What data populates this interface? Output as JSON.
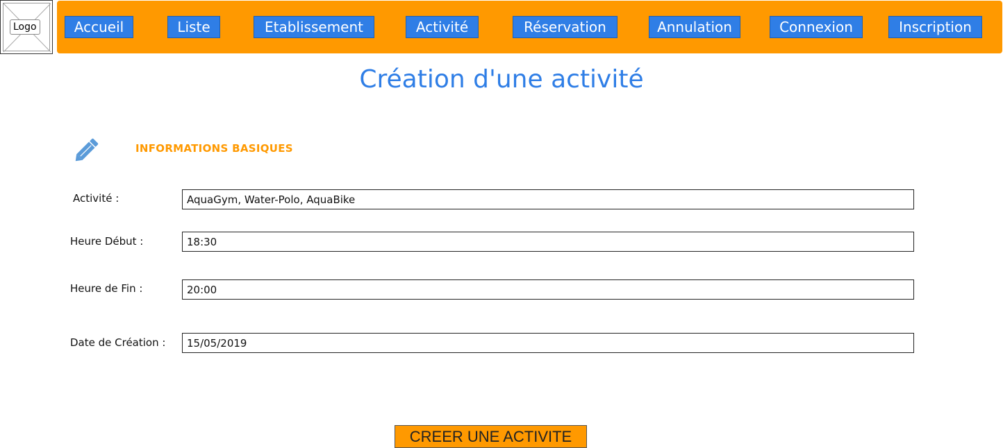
{
  "logo": {
    "label": "Logo"
  },
  "nav": {
    "items": [
      {
        "label": "Accueil"
      },
      {
        "label": "Liste"
      },
      {
        "label": "Etablissement"
      },
      {
        "label": "Activité"
      },
      {
        "label": "Réservation"
      },
      {
        "label": "Annulation"
      },
      {
        "label": "Connexion"
      },
      {
        "label": "Inscription"
      }
    ]
  },
  "page": {
    "title": "Création d'une activité"
  },
  "section": {
    "heading": "INFORMATIONS BASIQUES",
    "icon": "pencil-icon"
  },
  "form": {
    "activite": {
      "label": "Activité :",
      "value": "AquaGym, Water-Polo, AquaBike"
    },
    "heure_debut": {
      "label": "Heure Début :",
      "value": "18:30"
    },
    "heure_fin": {
      "label": "Heure de Fin :",
      "value": "20:00"
    },
    "date_creation": {
      "label": "Date de Création :",
      "value": "15/05/2019"
    }
  },
  "submit": {
    "label": "CREER UNE ACTIVITE"
  },
  "colors": {
    "nav_background": "#ff9900",
    "nav_button": "#2f7ee6",
    "title": "#2f7ee6",
    "section_heading": "#ff9900",
    "pencil_icon": "#5b9bd9",
    "submit_button": "#ff9900"
  }
}
